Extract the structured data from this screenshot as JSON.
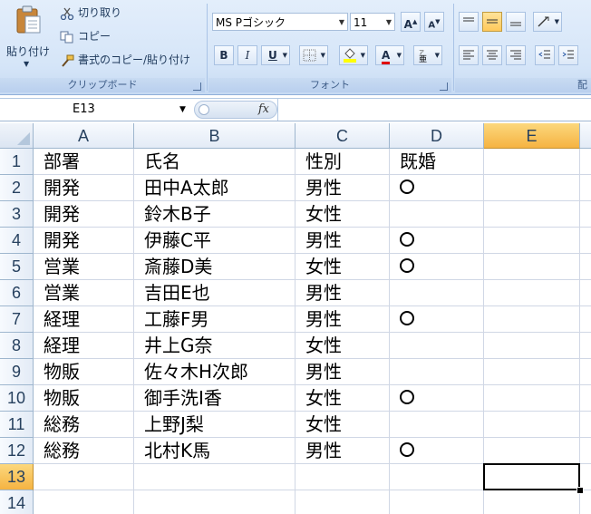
{
  "ribbon": {
    "clipboard": {
      "paste_label": "貼り付け",
      "cut_label": "切り取り",
      "copy_label": "コピー",
      "format_painter_label": "書式のコピー/貼り付け",
      "group_label": "クリップボード"
    },
    "font": {
      "font_name": "MS Pゴシック",
      "font_size": "11",
      "grow_label": "A",
      "shrink_label": "A",
      "bold_label": "B",
      "italic_label": "I",
      "underline_label": "U",
      "font_color_label": "A",
      "group_label": "フォント"
    },
    "alignment": {
      "group_label_partial": "配"
    }
  },
  "formula_bar": {
    "name_box": "E13",
    "fx_label": "fx",
    "formula": ""
  },
  "sheet": {
    "columns": [
      "A",
      "B",
      "C",
      "D",
      "E"
    ],
    "selected_column": "E",
    "selected_row": "13",
    "active_cell": "E13",
    "rows": [
      {
        "num": "1",
        "cells": [
          "部署",
          "氏名",
          "性別",
          "既婚"
        ]
      },
      {
        "num": "2",
        "cells": [
          "開発",
          "田中A太郎",
          "男性",
          "〇"
        ]
      },
      {
        "num": "3",
        "cells": [
          "開発",
          "鈴木B子",
          "女性",
          ""
        ]
      },
      {
        "num": "4",
        "cells": [
          "開発",
          "伊藤C平",
          "男性",
          "〇"
        ]
      },
      {
        "num": "5",
        "cells": [
          "営業",
          "斎藤D美",
          "女性",
          "〇"
        ]
      },
      {
        "num": "6",
        "cells": [
          "営業",
          "吉田E也",
          "男性",
          ""
        ]
      },
      {
        "num": "7",
        "cells": [
          "経理",
          "工藤F男",
          "男性",
          "〇"
        ]
      },
      {
        "num": "8",
        "cells": [
          "経理",
          "井上G奈",
          "女性",
          ""
        ]
      },
      {
        "num": "9",
        "cells": [
          "物販",
          "佐々木H次郎",
          "男性",
          ""
        ]
      },
      {
        "num": "10",
        "cells": [
          "物販",
          "御手洗I香",
          "女性",
          "〇"
        ]
      },
      {
        "num": "11",
        "cells": [
          "総務",
          "上野J梨",
          "女性",
          ""
        ]
      },
      {
        "num": "12",
        "cells": [
          "総務",
          "北村K馬",
          "男性",
          "〇"
        ]
      },
      {
        "num": "13",
        "cells": [
          "",
          "",
          "",
          ""
        ]
      },
      {
        "num": "14",
        "cells": [
          "",
          "",
          "",
          ""
        ]
      }
    ]
  }
}
